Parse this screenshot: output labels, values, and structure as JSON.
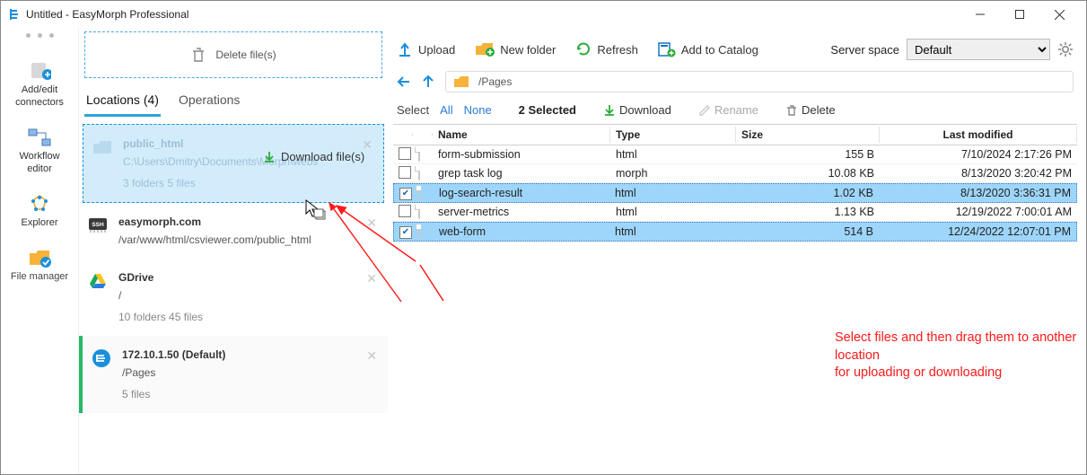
{
  "window": {
    "title": "Untitled - EasyMorph Professional"
  },
  "leftnav": [
    {
      "line1": "Add/edit",
      "line2": "connectors"
    },
    {
      "line1": "Workflow",
      "line2": "editor"
    },
    {
      "line1": "Explorer"
    },
    {
      "line1": "File manager"
    }
  ],
  "locations": {
    "delete_label": "Delete file(s)",
    "download_hint": "Download file(s)",
    "tabs": [
      "Locations (4)",
      "Operations"
    ],
    "items": [
      {
        "name": "public_html",
        "path": "C:\\Users\\Dmitry\\Documents\\Morph\\webs",
        "counts": "3 folders 5 files"
      },
      {
        "name": "easymorph.com",
        "path": "/var/www/html/csviewer.com/public_html",
        "counts": ""
      },
      {
        "name": "GDrive",
        "path": "/",
        "counts": "10 folders 45 files"
      },
      {
        "name": "172.10.1.50 (Default)",
        "path": "/Pages",
        "counts": "5 files"
      }
    ]
  },
  "toolbar": {
    "upload": "Upload",
    "newfolder": "New folder",
    "refresh": "Refresh",
    "catalog": "Add to Catalog",
    "server_space_label": "Server space",
    "server_space_value": "Default"
  },
  "crumb": {
    "path": "/Pages"
  },
  "selection": {
    "select_label": "Select",
    "all": "All",
    "none": "None",
    "count": "2 Selected",
    "download": "Download",
    "rename": "Rename",
    "delete": "Delete"
  },
  "table": {
    "headers": [
      "Name",
      "Type",
      "Size",
      "Last modified"
    ],
    "rows": [
      {
        "selected": false,
        "name": "form-submission",
        "type": "html",
        "size": "155 B",
        "modified": "7/10/2024 2:17:26 PM"
      },
      {
        "selected": false,
        "name": "grep task log",
        "type": "morph",
        "size": "10.08 KB",
        "modified": "8/13/2020 3:20:42 PM"
      },
      {
        "selected": true,
        "name": "log-search-result",
        "type": "html",
        "size": "1.02 KB",
        "modified": "8/13/2020 3:36:31 PM"
      },
      {
        "selected": false,
        "name": "server-metrics",
        "type": "html",
        "size": "1.13 KB",
        "modified": "12/19/2022 7:00:01 AM"
      },
      {
        "selected": true,
        "name": "web-form",
        "type": "html",
        "size": "514 B",
        "modified": "12/24/2022 12:07:01 PM"
      }
    ]
  },
  "annotation": {
    "line1": "Select files and then drag them to another location",
    "line2": "for uploading or downloading"
  }
}
